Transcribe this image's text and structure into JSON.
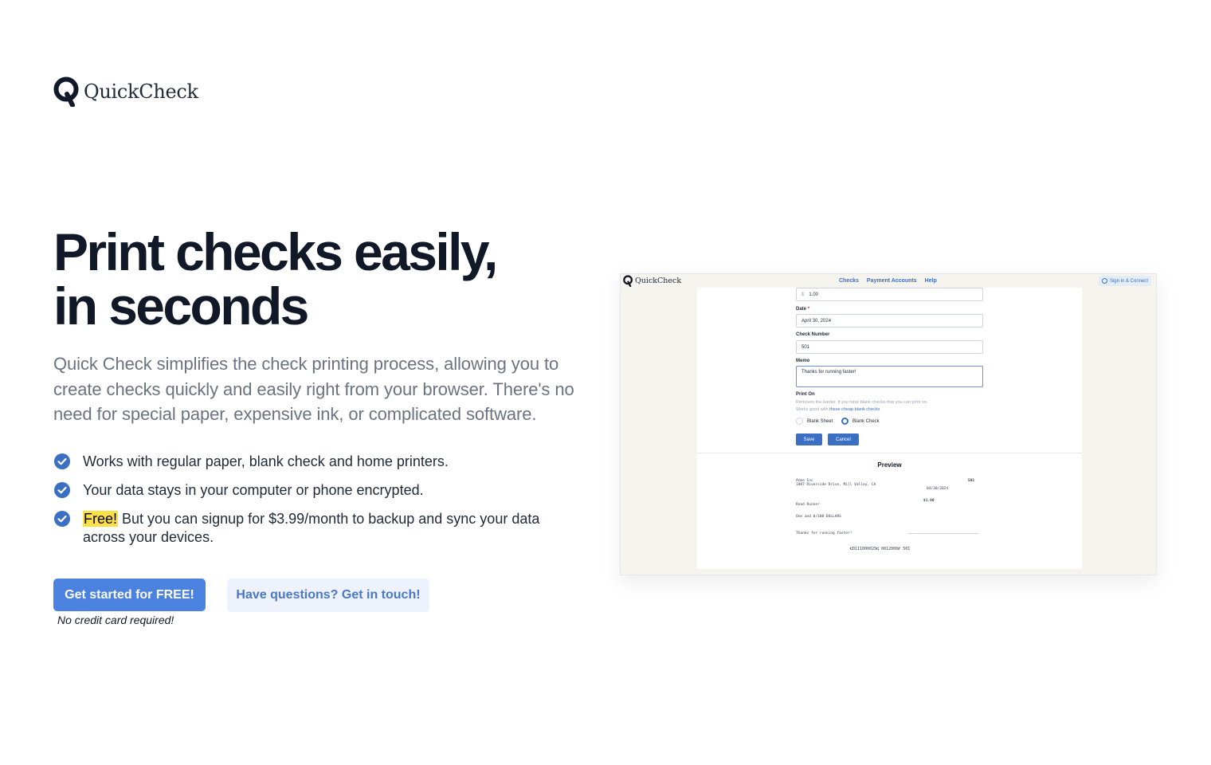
{
  "brand": {
    "name": "QuickCheck"
  },
  "hero": {
    "title_line1": "Print checks easily,",
    "title_line2": "in seconds",
    "subtitle": "Quick Check simplifies the check printing process, allowing you to create checks quickly and easily right from your browser. There's no need for special paper, expensive ink, or complicated software."
  },
  "features": [
    {
      "text": "Works with regular paper, blank check and home printers."
    },
    {
      "text": "Your data stays in your computer or phone encrypted."
    },
    {
      "highlight": "Free!",
      "text": " But you can signup for $3.99/month to backup and sync your data across your devices."
    }
  ],
  "cta": {
    "primary": "Get started for FREE!",
    "secondary": "Have questions? Get in touch!",
    "note": "No credit card required!"
  },
  "icons": {
    "feature": "check-circle-icon",
    "signin": "circle-icon"
  },
  "colors": {
    "primary": "#4b82e0",
    "secondary_bg": "#edf2fc",
    "highlight": "#fde047",
    "check_icon": "#3b6fc4"
  },
  "screenshot": {
    "logo": "QuickCheck",
    "nav": [
      "Checks",
      "Payment Accounts",
      "Help"
    ],
    "signin": "Sign in & Connect",
    "amount_prefix": "$",
    "amount": "1.00",
    "date_label": "Date",
    "date_required": "*",
    "date_value": "April 30, 2024",
    "check_number_label": "Check Number",
    "check_number_value": "501",
    "memo_label": "Memo",
    "memo_value": "Thanks for running faster!",
    "print_on_label": "Print On",
    "print_on_help1": "Removes the border, if you have blank checks that you can print on.",
    "print_on_help2": "Works good with ",
    "print_on_link": "these cheap blank checks",
    "radio_blank_sheet": "Blank Sheet",
    "radio_blank_check": "Blank Check",
    "save_btn": "Save",
    "cancel_btn": "Cancel",
    "preview_title": "Preview",
    "preview": {
      "company": "Acme Inc",
      "address": "1887 Riverside Drive, Mill Valley, CA",
      "check_no": "501",
      "date": "04/30/2024",
      "amount": "$1.00",
      "payee": "Road Runner",
      "words": "One and 0/100 DOLLARS",
      "memo": "Thanks for running faster!",
      "micr": "⑆0111000025⑆ 0012000⑈ 501"
    }
  }
}
